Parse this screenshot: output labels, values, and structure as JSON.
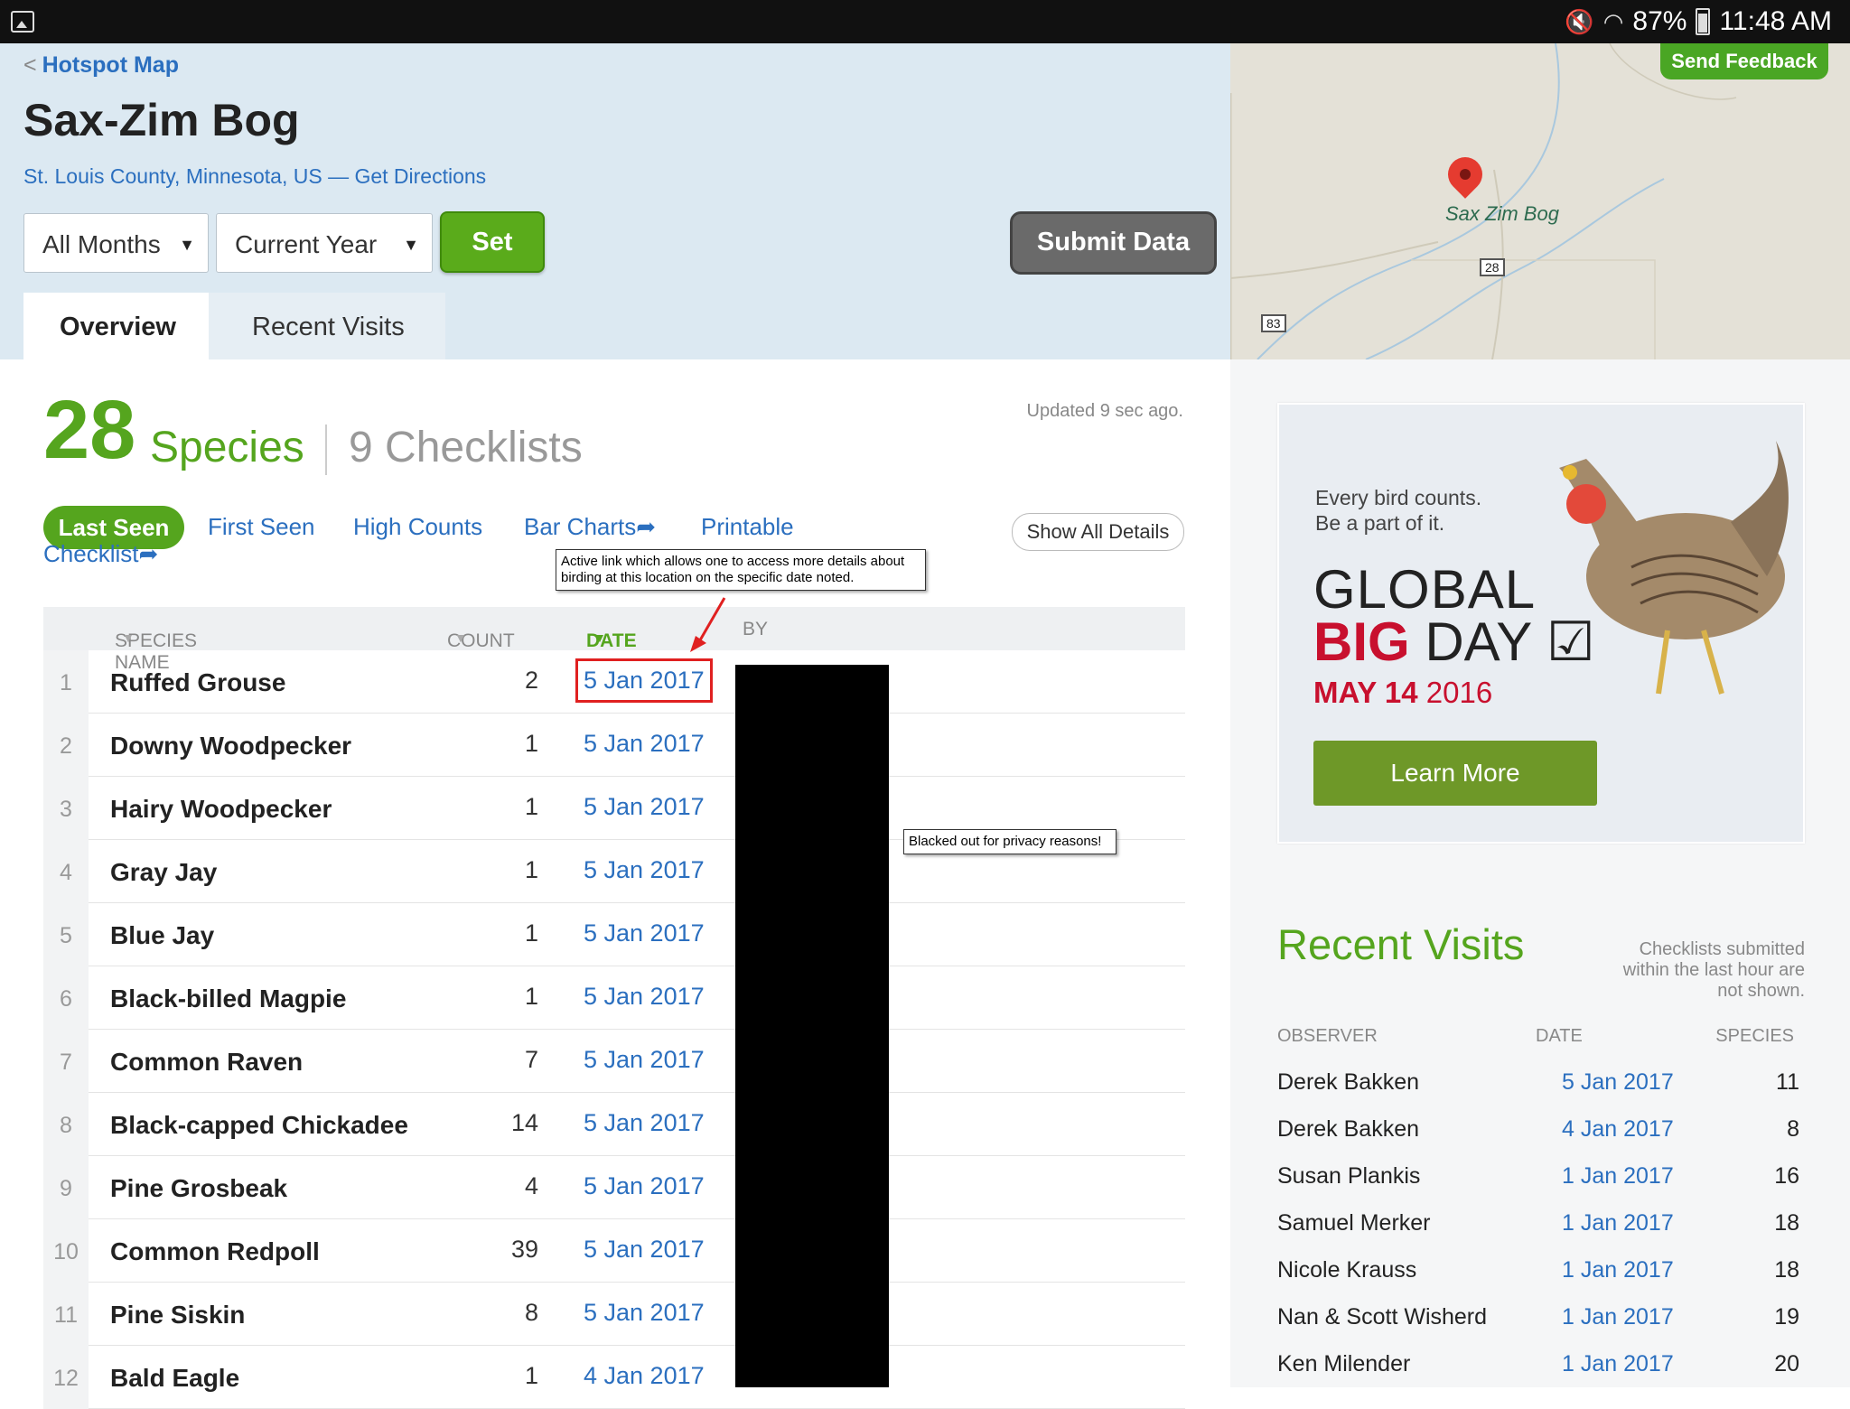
{
  "status_bar": {
    "battery": "87%",
    "time": "11:48 AM"
  },
  "header": {
    "back_link": "Hotspot Map",
    "title": "Sax-Zim Bog",
    "location": "St. Louis County, Minnesota, US — Get Directions",
    "filter_months": "All Months",
    "filter_year": "Current Year",
    "set_label": "Set",
    "submit_label": "Submit Data",
    "tabs": [
      {
        "label": "Overview"
      },
      {
        "label": "Recent Visits"
      }
    ]
  },
  "map": {
    "feedback_label": "Send Feedback",
    "place_label": "Sax Zim Bog",
    "road_labels": [
      "28",
      "83"
    ]
  },
  "summary": {
    "species_count": "28",
    "species_word": "Species",
    "checklists": "9 Checklists",
    "updated": "Updated 9 sec ago."
  },
  "views": {
    "last_seen": "Last Seen",
    "first_seen": "First Seen",
    "high_counts": "High Counts",
    "bar_charts": "Bar Charts",
    "printable": "Printable",
    "checklist": "Checklist",
    "show_all": "Show All Details"
  },
  "annotations": {
    "date_note": "Active link which allows one to access more details about birding at this location on the specific date noted.",
    "privacy_note": "Blacked out for privacy reasons!"
  },
  "table": {
    "headers": {
      "species": "SPECIES NAME",
      "count": "COUNT",
      "date": "DATE",
      "by": "BY"
    },
    "rows": [
      {
        "n": "1",
        "name": "Ruffed Grouse",
        "count": "2",
        "date": "5 Jan 2017"
      },
      {
        "n": "2",
        "name": "Downy Woodpecker",
        "count": "1",
        "date": "5 Jan 2017"
      },
      {
        "n": "3",
        "name": "Hairy Woodpecker",
        "count": "1",
        "date": "5 Jan 2017"
      },
      {
        "n": "4",
        "name": "Gray Jay",
        "count": "1",
        "date": "5 Jan 2017"
      },
      {
        "n": "5",
        "name": "Blue Jay",
        "count": "1",
        "date": "5 Jan 2017"
      },
      {
        "n": "6",
        "name": "Black-billed Magpie",
        "count": "1",
        "date": "5 Jan 2017"
      },
      {
        "n": "7",
        "name": "Common Raven",
        "count": "7",
        "date": "5 Jan 2017"
      },
      {
        "n": "8",
        "name": "Black-capped Chickadee",
        "count": "14",
        "date": "5 Jan 2017"
      },
      {
        "n": "9",
        "name": "Pine Grosbeak",
        "count": "4",
        "date": "5 Jan 2017"
      },
      {
        "n": "10",
        "name": "Common Redpoll",
        "count": "39",
        "date": "5 Jan 2017"
      },
      {
        "n": "11",
        "name": "Pine Siskin",
        "count": "8",
        "date": "5 Jan 2017"
      },
      {
        "n": "12",
        "name": "Bald Eagle",
        "count": "1",
        "date": "4 Jan 2017"
      }
    ]
  },
  "ad": {
    "line1": "Every bird counts.",
    "line2": "Be a part of it.",
    "global": "GLOBAL",
    "big": "BIG",
    "day": "DAY",
    "date_bold": "MAY 14",
    "date_year": "2016",
    "learn_more": "Learn More"
  },
  "recent_visits": {
    "title": "Recent Visits",
    "note": "Checklists submitted within the last hour are not shown.",
    "headers": {
      "observer": "OBSERVER",
      "date": "DATE",
      "species": "SPECIES"
    },
    "rows": [
      {
        "observer": "Derek Bakken",
        "date": "5 Jan 2017",
        "species": "11"
      },
      {
        "observer": "Derek Bakken",
        "date": "4 Jan 2017",
        "species": "8"
      },
      {
        "observer": "Susan Plankis",
        "date": "1 Jan 2017",
        "species": "16"
      },
      {
        "observer": "Samuel Merker",
        "date": "1 Jan 2017",
        "species": "18"
      },
      {
        "observer": "Nicole Krauss",
        "date": "1 Jan 2017",
        "species": "18"
      },
      {
        "observer": "Nan & Scott Wisherd",
        "date": "1 Jan 2017",
        "species": "19"
      },
      {
        "observer": "Ken Milender",
        "date": "1 Jan 2017",
        "species": "20"
      }
    ]
  },
  "colors": {
    "accent_green": "#55a51e",
    "link_blue": "#2b6fbf",
    "header_bg": "#dce9f2",
    "highlight_red": "#e02020"
  }
}
